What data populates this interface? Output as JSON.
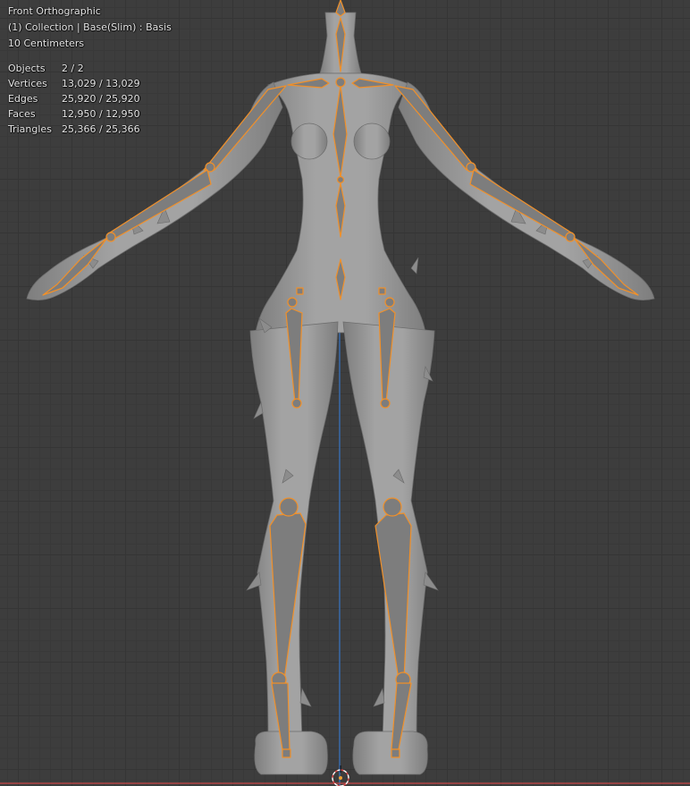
{
  "viewport": {
    "view_name": "Front Orthographic",
    "collection_info": "(1) Collection | Base(Slim) : Basis",
    "scale": "10 Centimeters",
    "stats": [
      {
        "label": "Objects",
        "value": "2 / 2"
      },
      {
        "label": "Vertices",
        "value": "13,029 / 13,029"
      },
      {
        "label": "Edges",
        "value": "25,920 / 25,920"
      },
      {
        "label": "Faces",
        "value": "12,950 / 12,950"
      },
      {
        "label": "Triangles",
        "value": "25,366 / 25,366"
      }
    ]
  },
  "colors": {
    "background": "#3d3d3d",
    "mesh": "#9a9a9a",
    "bone_outline": "#f0902a",
    "bone_fill": "#7d7d7d",
    "z_axis": "#3a78c8",
    "x_axis": "#c84848"
  }
}
